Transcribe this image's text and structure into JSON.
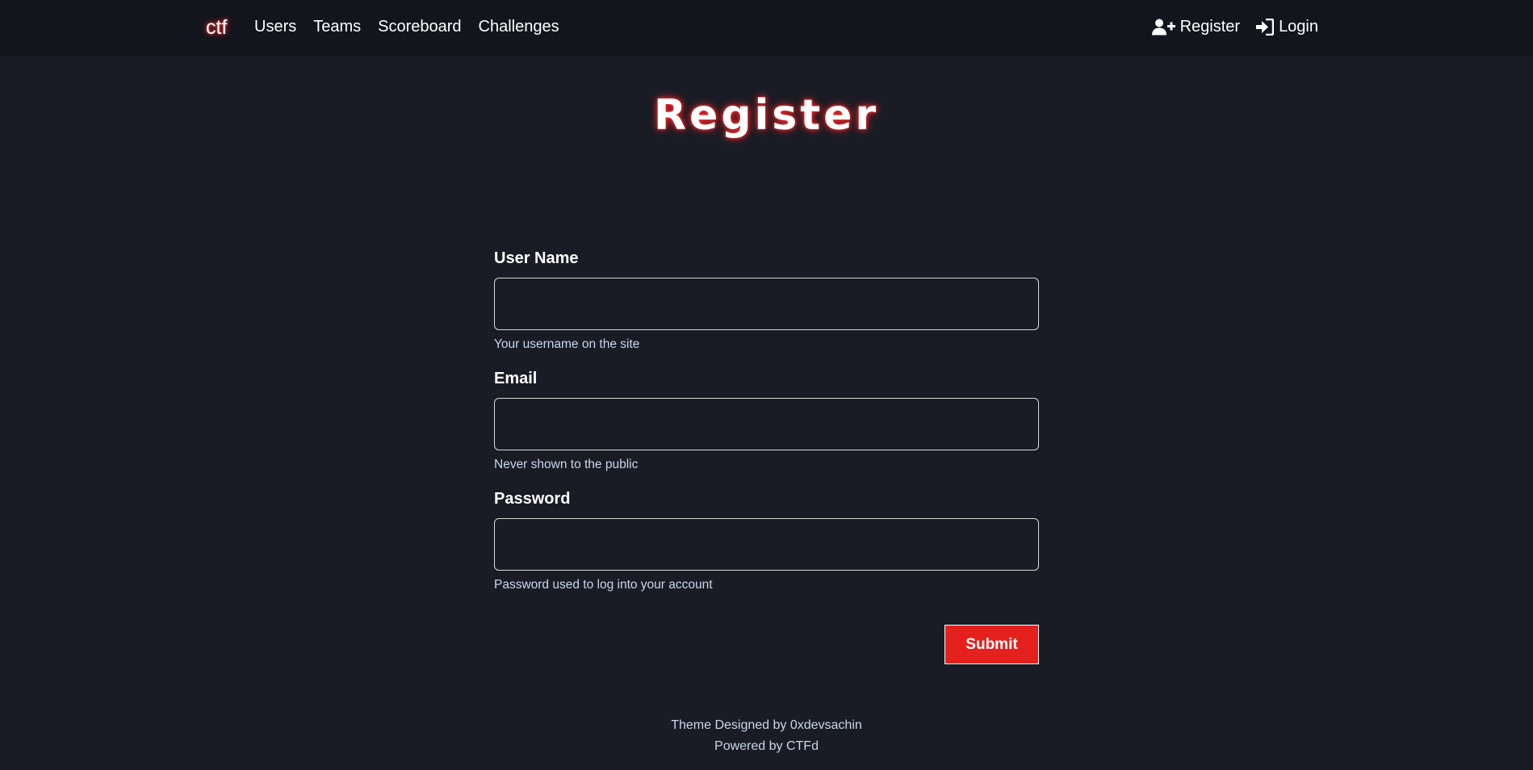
{
  "navbar": {
    "brand": "ctf",
    "left_links": [
      {
        "label": "Users"
      },
      {
        "label": "Teams"
      },
      {
        "label": "Scoreboard"
      },
      {
        "label": "Challenges"
      }
    ],
    "right_links": [
      {
        "label": "Register",
        "icon": "user-plus-icon"
      },
      {
        "label": "Login",
        "icon": "sign-in-icon"
      }
    ]
  },
  "page": {
    "title": "Register"
  },
  "form": {
    "username": {
      "label": "User Name",
      "value": "",
      "help": "Your username on the site"
    },
    "email": {
      "label": "Email",
      "value": "",
      "help": "Never shown to the public"
    },
    "password": {
      "label": "Password",
      "value": "",
      "help": "Password used to log into your account"
    },
    "submit_label": "Submit"
  },
  "footer": {
    "line1": "Theme Designed by 0xdevsachin",
    "line2": "Powered by CTFd"
  },
  "colors": {
    "background": "#1a1c25",
    "navbar": "#13151d",
    "accent": "#e5211d",
    "glow": "#ff2020",
    "help_text": "#c9d6ec"
  }
}
